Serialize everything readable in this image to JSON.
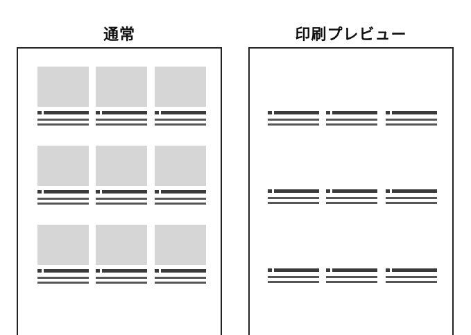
{
  "panels": [
    {
      "id": "normal",
      "title": "通常",
      "show_thumbnails": true,
      "rows": 3,
      "cols": 3
    },
    {
      "id": "print",
      "title": "印刷プレビュー",
      "show_thumbnails": false,
      "rows": 3,
      "cols": 3
    }
  ],
  "colors": {
    "frame": "#222222",
    "thumbnail": "#d6d6d6",
    "text_line": "#3a3a3a"
  }
}
